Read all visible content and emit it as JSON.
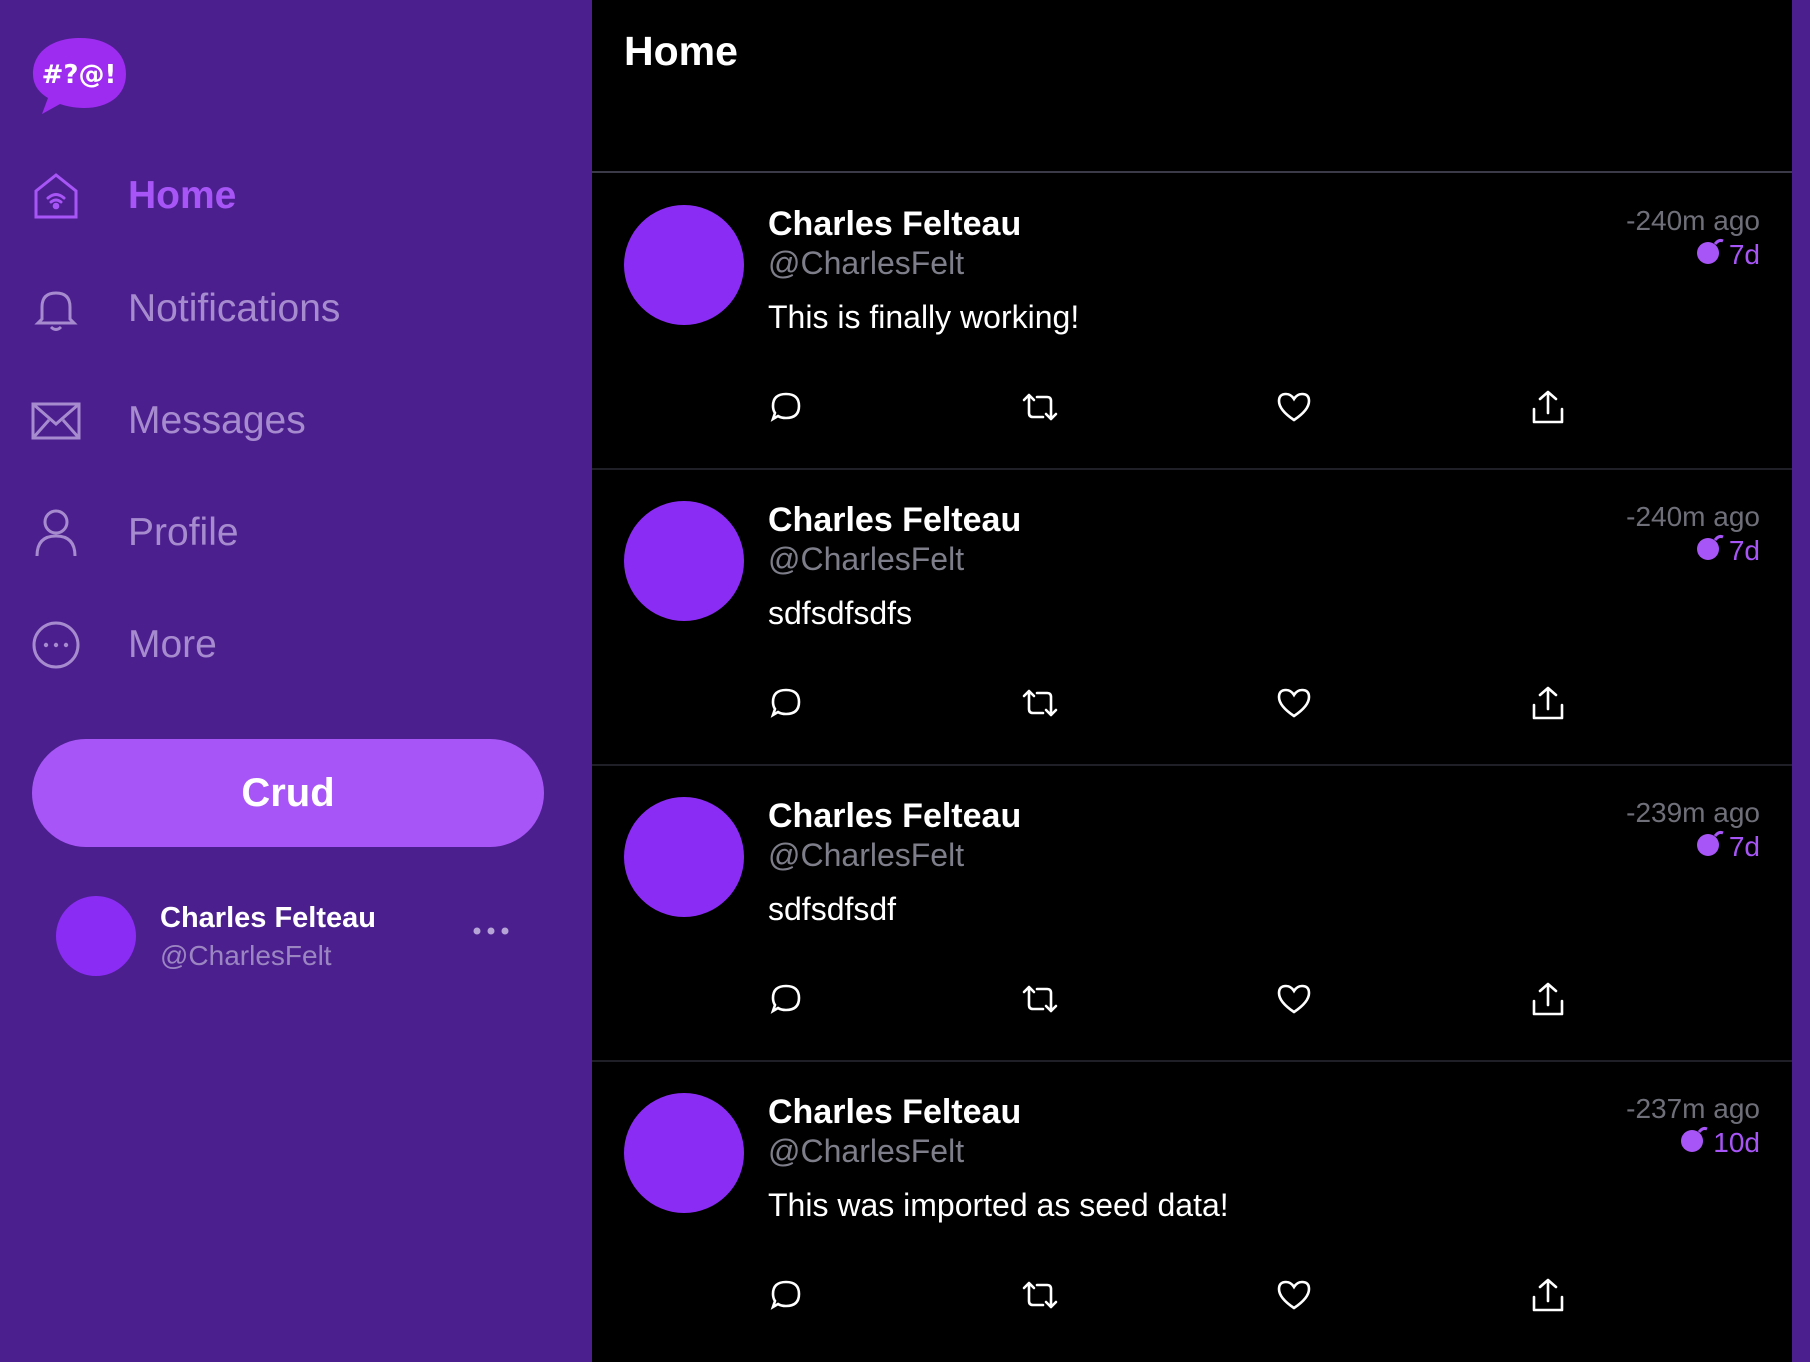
{
  "logo": {
    "text": "#?@!"
  },
  "colors": {
    "sidebar": "#4c1f8f",
    "accent": "#a855f7",
    "avatar": "#8b2cf5",
    "muted_nav": "#a78bcf"
  },
  "sidebar": {
    "items": [
      {
        "label": "Home",
        "icon": "home-icon",
        "active": true
      },
      {
        "label": "Notifications",
        "icon": "bell-icon",
        "active": false
      },
      {
        "label": "Messages",
        "icon": "mail-icon",
        "active": false
      },
      {
        "label": "Profile",
        "icon": "user-icon",
        "active": false
      },
      {
        "label": "More",
        "icon": "more-circle-icon",
        "active": false
      }
    ],
    "crud_button": "Crud",
    "account": {
      "name": "Charles Felteau",
      "handle": "@CharlesFelt"
    }
  },
  "header": {
    "title": "Home"
  },
  "tweets": [
    {
      "name": "Charles Felteau",
      "handle": "@CharlesFelt",
      "text": "This is finally working!",
      "time": "-240m ago",
      "expires": "7d"
    },
    {
      "name": "Charles Felteau",
      "handle": "@CharlesFelt",
      "text": "sdfsdfsdfs",
      "time": "-240m ago",
      "expires": "7d"
    },
    {
      "name": "Charles Felteau",
      "handle": "@CharlesFelt",
      "text": "sdfsdfsdf",
      "time": "-239m ago",
      "expires": "7d"
    },
    {
      "name": "Charles Felteau",
      "handle": "@CharlesFelt",
      "text": "This was imported as seed data!",
      "time": "-237m ago",
      "expires": "10d"
    }
  ]
}
